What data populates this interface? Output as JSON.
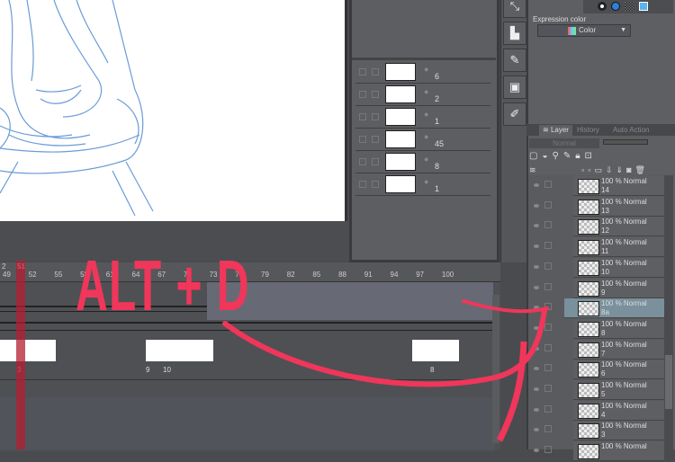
{
  "canvas": {
    "description_alt": "sketch"
  },
  "mid_panel": {
    "rows": [
      {
        "value": "6"
      },
      {
        "value": "2"
      },
      {
        "value": "1"
      },
      {
        "value": "45"
      },
      {
        "value": "8"
      },
      {
        "value": "1"
      }
    ]
  },
  "properties": {
    "expression_color_label": "Expression color",
    "color_select": "Color"
  },
  "layer_panel": {
    "tabs": [
      "Layer",
      "History",
      "Auto Action"
    ],
    "blend_mode": "Normal",
    "layers": [
      {
        "mode": "100 % Normal",
        "name": "14"
      },
      {
        "mode": "100 % Normal",
        "name": "13"
      },
      {
        "mode": "100 % Normal",
        "name": "12"
      },
      {
        "mode": "100 % Normal",
        "name": "11"
      },
      {
        "mode": "100 % Normal",
        "name": "10"
      },
      {
        "mode": "100 % Normal",
        "name": "9"
      },
      {
        "mode": "100 % Normal",
        "name": "8a",
        "selected": true
      },
      {
        "mode": "100 % Normal",
        "name": "8"
      },
      {
        "mode": "100 % Normal",
        "name": "7"
      },
      {
        "mode": "100 % Normal",
        "name": "6"
      },
      {
        "mode": "100 % Normal",
        "name": "5"
      },
      {
        "mode": "100 % Normal",
        "name": "4"
      },
      {
        "mode": "100 % Normal",
        "name": "3"
      },
      {
        "mode": "100 % Normal",
        "name": ""
      }
    ]
  },
  "timeline": {
    "current_frame": "51",
    "top_marker": "2",
    "ticks": [
      "49",
      "52",
      "55",
      "58",
      "61",
      "64",
      "67",
      "70",
      "73",
      "76",
      "79",
      "82",
      "85",
      "88",
      "91",
      "94",
      "97",
      "100"
    ],
    "frame_labels": [
      "3",
      "9",
      "10",
      "8"
    ]
  },
  "overlay": {
    "shortcut": "ALT + D",
    "color": "#f0365a"
  }
}
